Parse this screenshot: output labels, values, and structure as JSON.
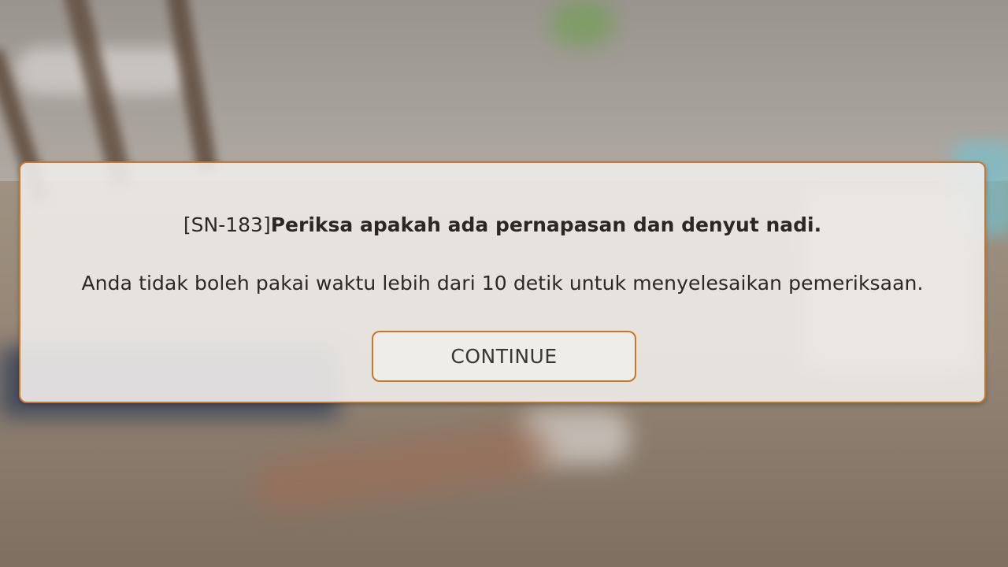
{
  "dialog": {
    "code": "[SN-183]",
    "instruction": "Periksa apakah ada pernapasan dan denyut nadi.",
    "body": "Anda tidak boleh pakai waktu lebih dari 10 detik untuk menyelesaikan pemeriksaan.",
    "continue_label": "CONTINUE"
  },
  "colors": {
    "accent_border": "#c8772a",
    "panel_background": "#eeecea",
    "text": "#2b2724"
  }
}
